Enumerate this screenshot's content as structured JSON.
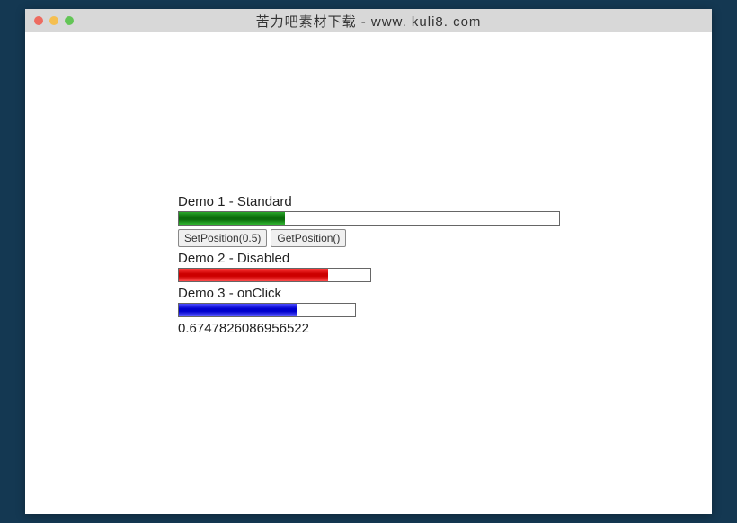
{
  "window": {
    "title": "苦力吧素材下载 - www. kuli8. com"
  },
  "demos": {
    "demo1": {
      "label": "Demo 1 - Standard",
      "fill_percent": 28,
      "color": "green"
    },
    "demo2": {
      "label": "Demo 2 - Disabled",
      "fill_percent": 78,
      "color": "red"
    },
    "demo3": {
      "label": "Demo 3 - onClick",
      "fill_percent": 67,
      "color": "blue"
    }
  },
  "buttons": {
    "set_position": "SetPosition(0.5)",
    "get_position": "GetPosition()"
  },
  "output_value": "0.6747826086956522"
}
